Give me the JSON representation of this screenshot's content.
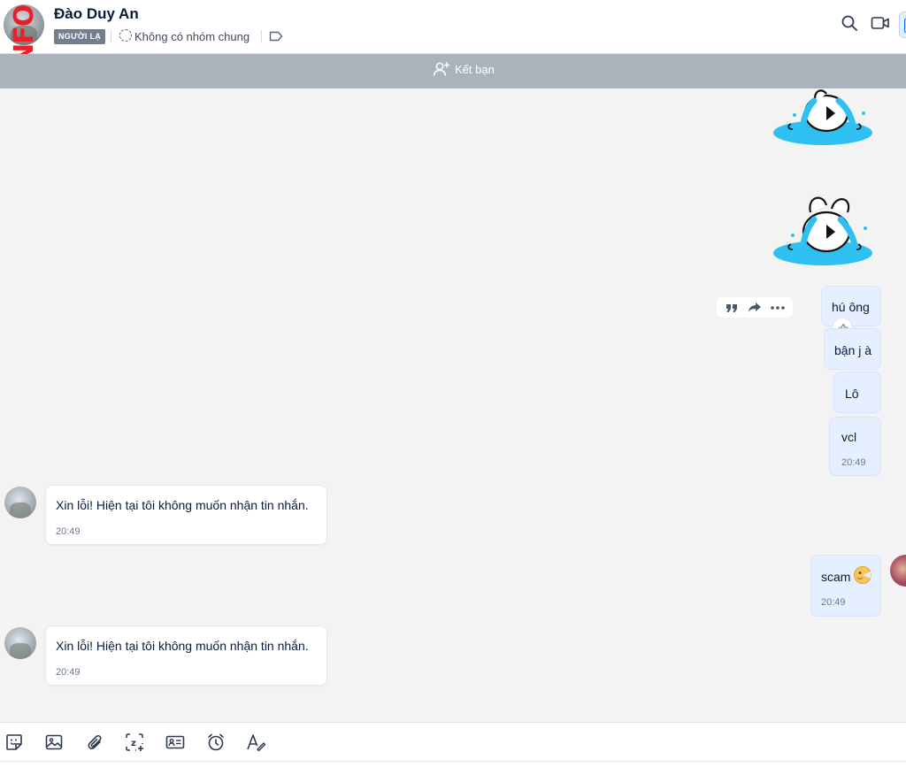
{
  "header": {
    "contact_name": "Đào Duy An",
    "badge": "NGƯỜI LẠ",
    "group_status": "Không có nhóm chung",
    "watermark": "INFO"
  },
  "friend_bar": {
    "label": "Kết bạn"
  },
  "messages": {
    "m1": {
      "text": "hú ông"
    },
    "m2": {
      "text": "bận j à"
    },
    "m3": {
      "text": "Lô"
    },
    "m4": {
      "text": "vcl",
      "time": "20:49"
    },
    "m5": {
      "text": "Xin lỗi! Hiện tại tôi không muốn nhận tin nhắn.",
      "time": "20:49"
    },
    "m6": {
      "text": "scam",
      "time": "20:49"
    },
    "m7": {
      "text": "Xin lỗi! Hiện tại tôi không muốn nhận tin nhắn.",
      "time": "20:49"
    }
  },
  "colors": {
    "accent": "#0068ff",
    "my_bubble": "#e5efff",
    "friend_bar": "#a9b3bc",
    "badge": "#72808e",
    "sticker": "#2ec0f0"
  },
  "icons": {
    "header": [
      "search-icon",
      "video-call-icon",
      "conversation-info-icon"
    ],
    "toolbar": [
      "sticker-icon",
      "image-icon",
      "attachment-icon",
      "screenshot-icon",
      "contact-card-icon",
      "reminder-icon",
      "text-format-icon"
    ],
    "hover": [
      "quote-icon",
      "forward-icon",
      "more-icon"
    ]
  }
}
